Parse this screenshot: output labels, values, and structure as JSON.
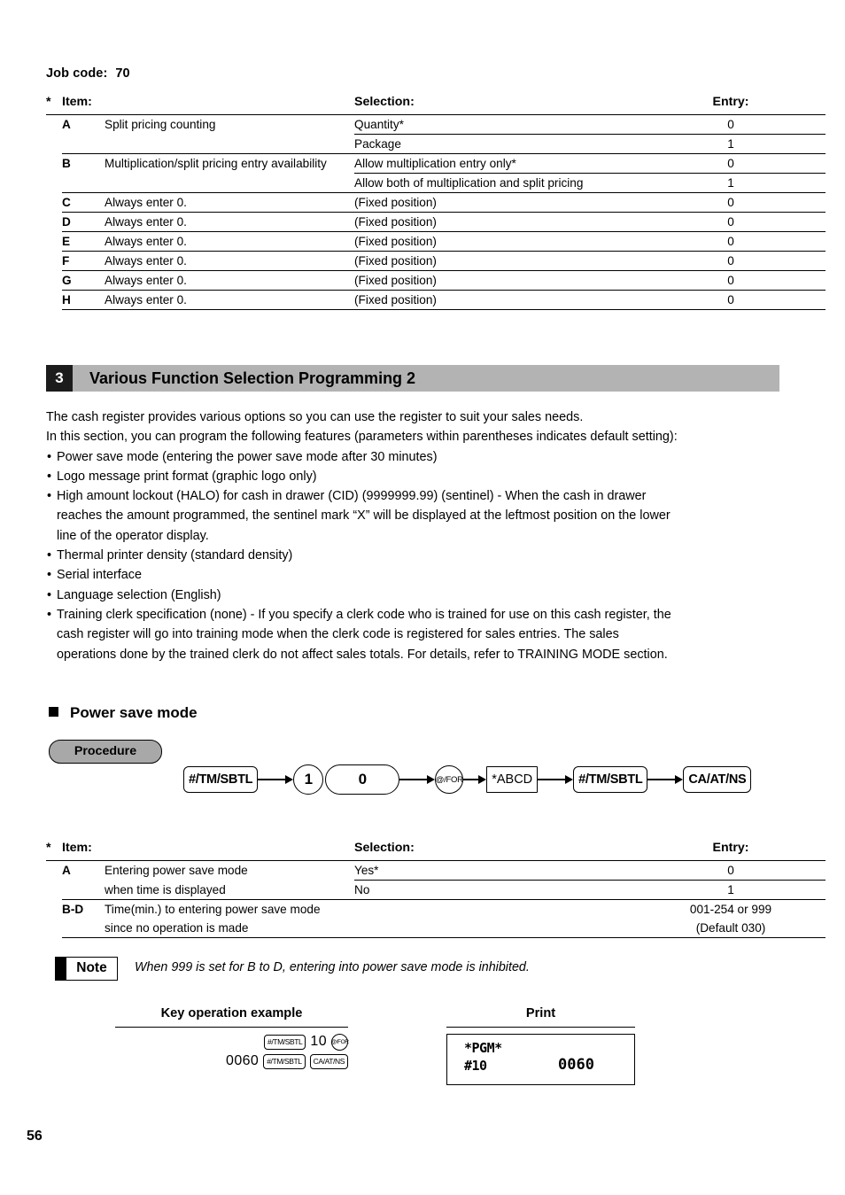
{
  "job": {
    "label": "Job code:",
    "number": "70"
  },
  "table1": {
    "star": "*",
    "headers": {
      "item": "Item:",
      "selection": "Selection:",
      "entry": "Entry:"
    },
    "rows": [
      {
        "letter": "A",
        "item": "Split pricing counting",
        "selection": "Quantity*",
        "entry": "0"
      },
      {
        "letter": "",
        "item": "",
        "selection": "Package",
        "entry": "1"
      },
      {
        "letter": "B",
        "item": "Multiplication/split pricing entry availability",
        "selection": "Allow multiplication entry only*",
        "entry": "0"
      },
      {
        "letter": "",
        "item": "",
        "selection": "Allow both of multiplication and split pricing",
        "entry": "1"
      },
      {
        "letter": "C",
        "item": "Always enter 0.",
        "selection": "(Fixed position)",
        "entry": "0"
      },
      {
        "letter": "D",
        "item": "Always enter 0.",
        "selection": "(Fixed position)",
        "entry": "0"
      },
      {
        "letter": "E",
        "item": "Always enter 0.",
        "selection": "(Fixed position)",
        "entry": "0"
      },
      {
        "letter": "F",
        "item": "Always enter 0.",
        "selection": "(Fixed position)",
        "entry": "0"
      },
      {
        "letter": "G",
        "item": "Always enter 0.",
        "selection": "(Fixed position)",
        "entry": "0"
      },
      {
        "letter": "H",
        "item": "Always enter 0.",
        "selection": "(Fixed position)",
        "entry": "0"
      }
    ]
  },
  "section": {
    "number": "3",
    "title": "Various Function Selection Programming 2",
    "band_color": "#b3b3b3",
    "num_bg_color": "#1c1c1c"
  },
  "intro": {
    "p1": "The cash register provides various options so you can use the register to suit your sales needs.",
    "p2": "In this section, you can program the following features (parameters within parentheses indicates default setting):",
    "bullets": [
      {
        "text": "Power save mode (entering the power save mode after 30 minutes)",
        "cont": []
      },
      {
        "text": "Logo message print format (graphic logo only)",
        "cont": []
      },
      {
        "text": "High amount lockout (HALO) for cash in drawer (CID) (9999999.99) (sentinel) - When the cash in drawer",
        "cont": [
          "reaches the amount programmed, the sentinel mark “X” will be displayed at the leftmost position on the lower",
          "line of the operator display."
        ]
      },
      {
        "text": "Thermal printer density (standard density)",
        "cont": []
      },
      {
        "text": "Serial interface",
        "cont": []
      },
      {
        "text": "Language selection (English)",
        "cont": []
      },
      {
        "text": "Training clerk specification (none) - If you specify a clerk code who is trained for use on this cash register, the",
        "cont": [
          "cash register will go into training mode when the clerk code is registered for sales entries.  The sales",
          "operations done by the trained clerk do not affect sales totals.  For details, refer to TRAINING MODE section."
        ]
      }
    ]
  },
  "subsection": {
    "title": "Power save mode"
  },
  "procedure": {
    "label": "Procedure",
    "keys": [
      {
        "id": "key-tm-sbtl-1",
        "label": "#/TM/SBTL",
        "shape": "rounded-rect"
      },
      {
        "id": "arrow-1",
        "label": "",
        "shape": "arrow"
      },
      {
        "id": "key-digit-1",
        "label": "1",
        "shape": "circle"
      },
      {
        "id": "key-digit-0",
        "label": "0",
        "shape": "oval"
      },
      {
        "id": "arrow-2",
        "label": "",
        "shape": "arrow"
      },
      {
        "id": "key-at-for",
        "label": "@/FOR",
        "shape": "circle-small"
      },
      {
        "id": "arrow-3",
        "label": "",
        "shape": "arrow-short"
      },
      {
        "id": "key-abcd",
        "label": "*ABCD",
        "shape": "square-rect"
      },
      {
        "id": "arrow-4",
        "label": "",
        "shape": "arrow"
      },
      {
        "id": "key-tm-sbtl-2",
        "label": "#/TM/SBTL",
        "shape": "rounded-rect"
      },
      {
        "id": "arrow-5",
        "label": "",
        "shape": "arrow"
      },
      {
        "id": "key-ca-at-ns",
        "label": "CA/AT/NS",
        "shape": "rounded-rect"
      }
    ]
  },
  "table2": {
    "star": "*",
    "headers": {
      "item": "Item:",
      "selection": "Selection:",
      "entry": "Entry:"
    },
    "rows": [
      {
        "letter": "A",
        "item": "Entering power save mode",
        "selection": "Yes*",
        "entry": "0"
      },
      {
        "letter": "",
        "item": "when time is displayed",
        "selection": "No",
        "entry": "1"
      },
      {
        "letter": "B-D",
        "item": "Time(min.) to entering power save mode",
        "selection": "",
        "entry": "001-254 or 999"
      },
      {
        "letter": "",
        "item": "since no operation is made",
        "selection": "",
        "entry": "(Default 030)"
      }
    ]
  },
  "note": {
    "label": "Note",
    "text": "When 999 is set for B to D, entering into power save mode is inhibited."
  },
  "example": {
    "key_operation_heading": "Key operation example",
    "print_heading": "Print",
    "key_lines": [
      {
        "items": [
          {
            "type": "key",
            "label": "#/TM/SBTL",
            "shape": "rounded-rect"
          },
          {
            "type": "text",
            "label": "10"
          },
          {
            "type": "key",
            "label": "@/FOR",
            "shape": "circle"
          }
        ]
      },
      {
        "items": [
          {
            "type": "text",
            "label": "0060"
          },
          {
            "type": "key",
            "label": "#/TM/SBTL",
            "shape": "rounded-rect"
          },
          {
            "type": "key",
            "label": "CA/AT/NS",
            "shape": "rounded-rect"
          }
        ]
      }
    ],
    "print": {
      "line1": "*PGM*",
      "line2_left": "#10",
      "line2_right": "0060"
    }
  },
  "page_number": "56"
}
